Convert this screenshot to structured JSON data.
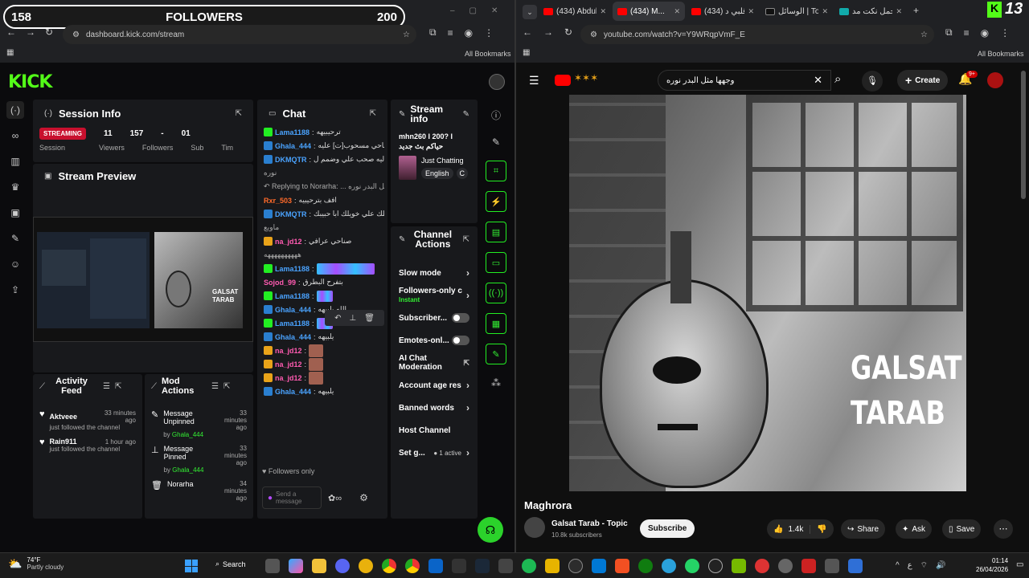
{
  "left_browser": {
    "overlay": {
      "left_count": "158",
      "title": "FOLLOWERS",
      "right_count": "200"
    },
    "url": "dashboard.kick.com/stream",
    "bookmarks": "All Bookmarks"
  },
  "kick": {
    "logo": "KICK",
    "session": {
      "title": "Session Info",
      "status": "STREAMING",
      "viewers": "11",
      "viewers_label": "Viewers",
      "followers": "157",
      "followers_label": "Followers",
      "subs": "-",
      "subs_label": "Sub",
      "extra": "01",
      "extra_label": "Tim",
      "session_label": "Session"
    },
    "preview": {
      "title": "Stream Preview",
      "overlay_text": "GALSAT TARAB"
    },
    "chat": {
      "title": "Chat",
      "lines": [
        {
          "user": "Lama1188",
          "badge": "g",
          "text": "ترحيبيهه",
          "ucls": "un"
        },
        {
          "user": "Ghala_444",
          "badge": "b",
          "text": "صناحي مسحوب[ت] عليه",
          "ucls": "un"
        },
        {
          "user": "DKMQTR",
          "badge": "b",
          "text": "ليه صحب علي وضمم ل",
          "ucls": "un"
        },
        {
          "user": "",
          "badge": "",
          "text": "نوره",
          "ucls": "un"
        },
        {
          "user": "",
          "badge": "",
          "text": "↶ Replying to Norarha: ... مثل البدر نوره",
          "ucls": "un"
        },
        {
          "user": "Rxr_503",
          "badge": "",
          "text": "افف بترحيبيه",
          "ucls": "un or"
        },
        {
          "user": "DKMQTR",
          "badge": "b",
          "text": "عيلك علي خويلك ابا حبيبك",
          "ucls": "un"
        },
        {
          "user": "",
          "badge": "",
          "text": "ماويع",
          "ucls": "un"
        },
        {
          "user": "na_jd12",
          "badge": "y",
          "text": "صناحي عرافي",
          "ucls": "un pk"
        },
        {
          "user": "",
          "badge": "",
          "text": "ههههههههههه",
          "ucls": "un"
        },
        {
          "user": "Lama1188",
          "badge": "g",
          "text": "",
          "ucls": "un"
        },
        {
          "user": "Sojod_99",
          "badge": "",
          "text": "بتفرح البطرق",
          "ucls": "un pk"
        },
        {
          "user": "Lama1188",
          "badge": "g",
          "text": "",
          "ucls": "un"
        },
        {
          "user": "Ghala_444",
          "badge": "b",
          "text": "الله يلبيهه",
          "ucls": "un"
        },
        {
          "user": "Lama1188",
          "badge": "g",
          "text": "",
          "ucls": "un"
        },
        {
          "user": "Ghala_444",
          "badge": "b",
          "text": "يلبيهه",
          "ucls": "un"
        },
        {
          "user": "na_jd12",
          "badge": "y",
          "text": "",
          "ucls": "un pk"
        },
        {
          "user": "na_jd12",
          "badge": "y",
          "text": "",
          "ucls": "un pk"
        },
        {
          "user": "na_jd12",
          "badge": "y",
          "text": "",
          "ucls": "un pk"
        },
        {
          "user": "Ghala_444",
          "badge": "b",
          "text": "يلبيهه",
          "ucls": "un"
        }
      ],
      "followers_only": "Followers only",
      "send_placeholder": "Send a message"
    },
    "stream_info": {
      "title": "Stream info",
      "stream_title": "mhn260 I 200? I حياكم بث جديد",
      "category": "Just Chatting",
      "tag": "English",
      "tag2": "C"
    },
    "channel_actions": {
      "title": "Channel Actions",
      "items": [
        {
          "label": "Slow mode",
          "ctrl": "chev"
        },
        {
          "label": "Followers-only c",
          "sub": "Instant",
          "ctrl": "chev"
        },
        {
          "label": "Subscriber...",
          "ctrl": "toggle"
        },
        {
          "label": "Emotes-onl...",
          "ctrl": "toggle"
        },
        {
          "label": "AI Chat Moderation",
          "ctrl": "ext"
        },
        {
          "label": "Account age res",
          "ctrl": "chev"
        },
        {
          "label": "Banned words",
          "ctrl": "chev"
        },
        {
          "label": "Host Channel",
          "ctrl": ""
        },
        {
          "label": "Set g...",
          "sub2": "1 active",
          "ctrl": "chev"
        }
      ]
    },
    "activity": {
      "title": "Activity Feed",
      "items": [
        {
          "user": "Aktveee",
          "time": "33 minutes ago",
          "text": "just followed the channel"
        },
        {
          "user": "Rain911",
          "time": "1 hour ago",
          "text": "just followed the channel"
        }
      ]
    },
    "mod": {
      "title": "Mod Actions",
      "items": [
        {
          "action": "Message Unpinned",
          "by": "by",
          "user": "Ghala_444",
          "time": "33 minutes ago"
        },
        {
          "action": "Message Pinned",
          "by": "by",
          "user": "Ghala_444",
          "time": "33 minutes ago"
        },
        {
          "action": "Norarha",
          "by": "",
          "user": "",
          "time": "34 minutes ago"
        }
      ]
    }
  },
  "right_browser": {
    "tabs": [
      "(434) Abdul...",
      "(434) M...",
      "(434) قلبي د...",
      "الوسائل | Tok",
      "أجمل نكت مد..."
    ],
    "url": "youtube.com/watch?v=Y9WRqpVmF_E",
    "bookmarks": "All Bookmarks",
    "search": "وجهها مثل البدر نوره",
    "create": "Create",
    "notif": "9+",
    "video_overlay": [
      "GALSAT",
      "TARAB"
    ],
    "video_title": "Maghrora",
    "channel": "Galsat Tarab - Topic",
    "subs": "10.8k subscribers",
    "subscribe": "Subscribe",
    "likes": "1.4k",
    "share": "Share",
    "ask": "Ask",
    "save": "Save",
    "logo_num": "13"
  },
  "taskbar": {
    "weather_temp": "74°F",
    "weather_desc": "Partly cloudy",
    "search": "Search",
    "time": "01:14",
    "date": "26/04/2026"
  }
}
